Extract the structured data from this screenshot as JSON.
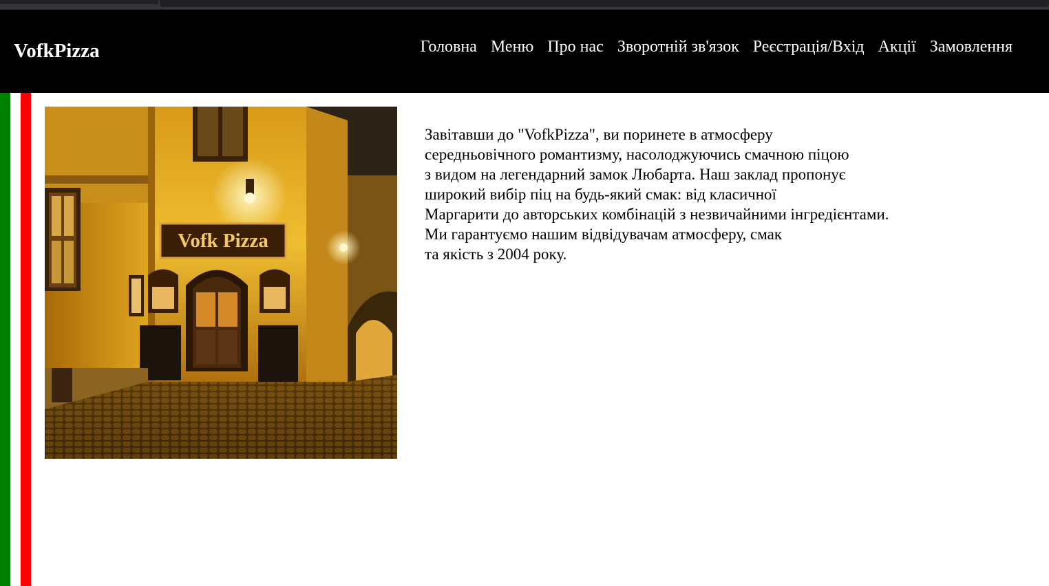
{
  "header": {
    "logo": "VofkPizza",
    "nav": [
      {
        "label": "Головна"
      },
      {
        "label": "Меню"
      },
      {
        "label": "Про нас"
      },
      {
        "label": "Зворотній зв'язок"
      },
      {
        "label": "Реєстрація/Вхід"
      },
      {
        "label": "Акції"
      },
      {
        "label": "Замовлення"
      }
    ]
  },
  "photo": {
    "sign_text": "Vofk Pizza"
  },
  "about": {
    "lines": [
      "Завітавши до \"VofkPizza\", ви поринете в атмосферу",
      "середньовічного романтизму, насолоджуючись смачною піцою",
      "з видом на легендарний замок Любарта. Наш заклад пропонує",
      "широкий вибір піц на будь-який смак: від класичної",
      "Маргарити до авторських комбінацій з незвичайними інгредієнтами.",
      "Ми гарантуємо нашим відвідувачам атмосферу, смак",
      "та якість з 2004 року."
    ]
  },
  "colors": {
    "header_bg": "#000000",
    "stripe_green": "#008000",
    "stripe_white": "#ffffff",
    "stripe_red": "#ff0000"
  }
}
